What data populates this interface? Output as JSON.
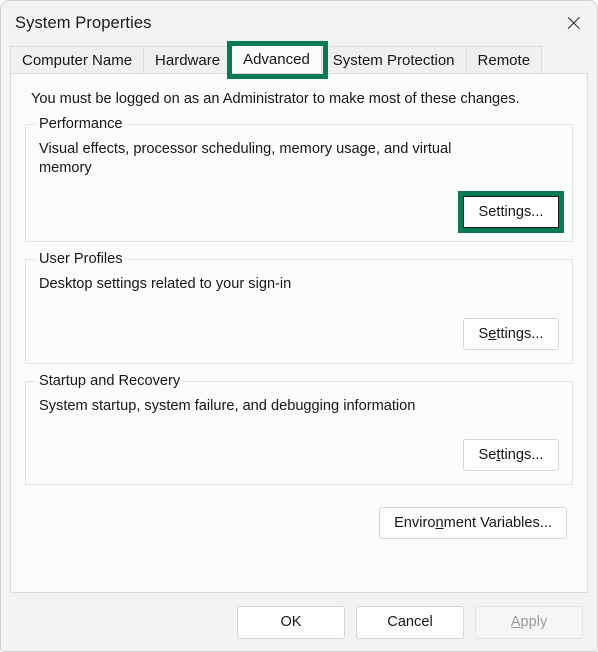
{
  "window": {
    "title": "System Properties",
    "close_icon": "close-icon"
  },
  "highlight_color": "#0a7a52",
  "tabs": [
    {
      "label": "Computer Name",
      "selected": false,
      "highlighted": false
    },
    {
      "label": "Hardware",
      "selected": false,
      "highlighted": false
    },
    {
      "label": "Advanced",
      "selected": true,
      "highlighted": true
    },
    {
      "label": "System Protection",
      "selected": false,
      "highlighted": false
    },
    {
      "label": "Remote",
      "selected": false,
      "highlighted": false
    }
  ],
  "page": {
    "notice": "You must be logged on as an Administrator to make most of these changes.",
    "groups": [
      {
        "title": "Performance",
        "description": "Visual effects, processor scheduling, memory usage, and virtual memory",
        "button": {
          "label": "Settings...",
          "accel_before": "S",
          "accel_char": "",
          "accel_after": "ettings...",
          "accelerator": "S",
          "highlighted": true,
          "disabled": false
        }
      },
      {
        "title": "User Profiles",
        "description": "Desktop settings related to your sign-in",
        "button": {
          "label": "Settings...",
          "accel_before": "S",
          "accel_char": "e",
          "accel_after": "ttings...",
          "accelerator": "e",
          "highlighted": false,
          "disabled": false
        }
      },
      {
        "title": "Startup and Recovery",
        "description": "System startup, system failure, and debugging information",
        "button": {
          "label": "Settings...",
          "accel_before": "Se",
          "accel_char": "t",
          "accel_after": "tings...",
          "accelerator": "t",
          "highlighted": false,
          "disabled": false
        }
      }
    ],
    "environment_button": {
      "label": "Environment Variables...",
      "accel_before": "Enviro",
      "accel_char": "n",
      "accel_after": "ment Variables...",
      "accelerator": "n"
    }
  },
  "footer": {
    "ok": {
      "label": "OK",
      "disabled": false
    },
    "cancel": {
      "label": "Cancel",
      "disabled": false
    },
    "apply": {
      "label": "Apply",
      "accel_before": "",
      "accel_char": "A",
      "accel_after": "pply",
      "accelerator": "A",
      "disabled": true
    }
  }
}
